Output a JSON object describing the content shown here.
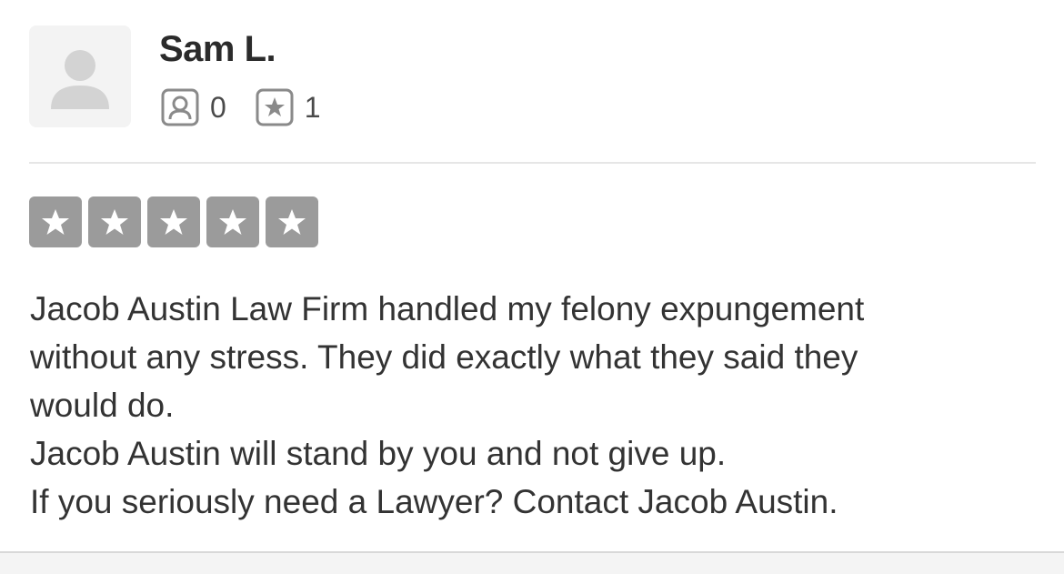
{
  "reviewer": {
    "name": "Sam L.",
    "avatar_icon": "default-user-silhouette-icon",
    "friends_icon": "friends-icon",
    "friends_count": "0",
    "reviews_icon": "reviews-star-icon",
    "reviews_count": "1"
  },
  "rating": {
    "stars": 5,
    "max_stars": 5,
    "star_color": "#9b9b9b"
  },
  "review": {
    "lines": [
      "Jacob Austin Law Firm handled my felony expungement",
      "without any stress. They did exactly what they said they",
      "would do.",
      "Jacob Austin will stand by you and not give up.",
      "If you seriously need a Lawyer? Contact Jacob Austin."
    ]
  }
}
